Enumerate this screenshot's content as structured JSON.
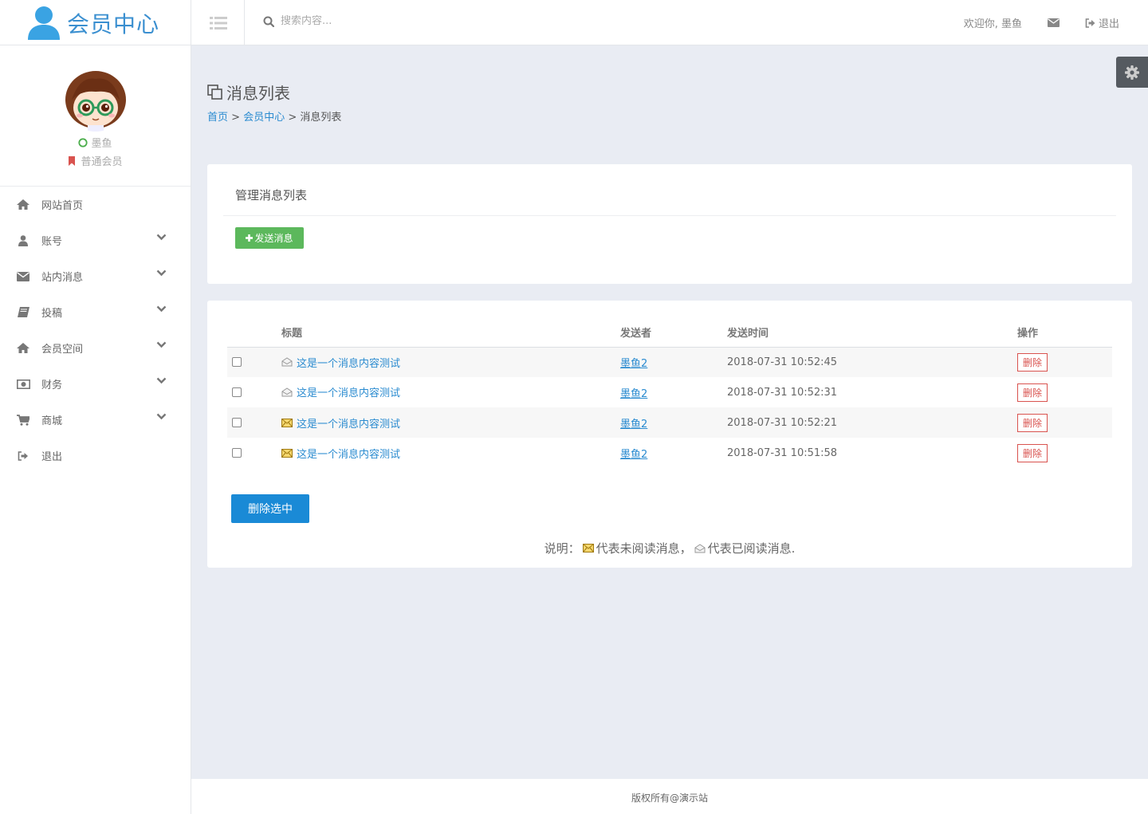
{
  "header": {
    "brand": "会员中心",
    "search_placeholder": "搜索内容...",
    "welcome": "欢迎你, 墨鱼",
    "logout": "退出"
  },
  "profile": {
    "username": "墨鱼",
    "level": "普通会员"
  },
  "nav": [
    {
      "label": "网站首页",
      "icon": "home-icon",
      "has_children": false
    },
    {
      "label": "账号",
      "icon": "user-icon",
      "has_children": true
    },
    {
      "label": "站内消息",
      "icon": "envelope-icon",
      "has_children": true
    },
    {
      "label": "投稿",
      "icon": "book-icon",
      "has_children": true
    },
    {
      "label": "会员空间",
      "icon": "home-icon",
      "has_children": true
    },
    {
      "label": "财务",
      "icon": "money-icon",
      "has_children": true
    },
    {
      "label": "商城",
      "icon": "cart-icon",
      "has_children": true
    },
    {
      "label": "退出",
      "icon": "sign-out-icon",
      "has_children": false
    }
  ],
  "page": {
    "title": "消息列表",
    "breadcrumb": [
      "首页",
      "会员中心",
      "消息列表"
    ],
    "breadcrumb_sep": ">"
  },
  "panel1": {
    "title": "管理消息列表",
    "send_button": "发送消息"
  },
  "table": {
    "headers": [
      "标题",
      "发送者",
      "发送时间",
      "操作"
    ],
    "rows": [
      {
        "title": "这是一个消息内容测试",
        "sender": "墨鱼2",
        "time": "2018-07-31 10:52:45",
        "read": true,
        "action": "删除"
      },
      {
        "title": "这是一个消息内容测试",
        "sender": "墨鱼2",
        "time": "2018-07-31 10:52:31",
        "read": true,
        "action": "删除"
      },
      {
        "title": "这是一个消息内容测试",
        "sender": "墨鱼2",
        "time": "2018-07-31 10:52:21",
        "read": false,
        "action": "删除"
      },
      {
        "title": "这是一个消息内容测试",
        "sender": "墨鱼2",
        "time": "2018-07-31 10:51:58",
        "read": false,
        "action": "删除"
      }
    ]
  },
  "delete_selected": "删除选中",
  "legend": {
    "prefix": "说明：",
    "unread": "代表未阅读消息，",
    "read": "代表已阅读消息."
  },
  "footer": "版权所有@演示站",
  "colors": {
    "accent": "#2a8bd0",
    "success": "#5cb85c",
    "danger": "#d9534f",
    "primary_button": "#1a8ad6",
    "background": "#e9ecf3"
  }
}
